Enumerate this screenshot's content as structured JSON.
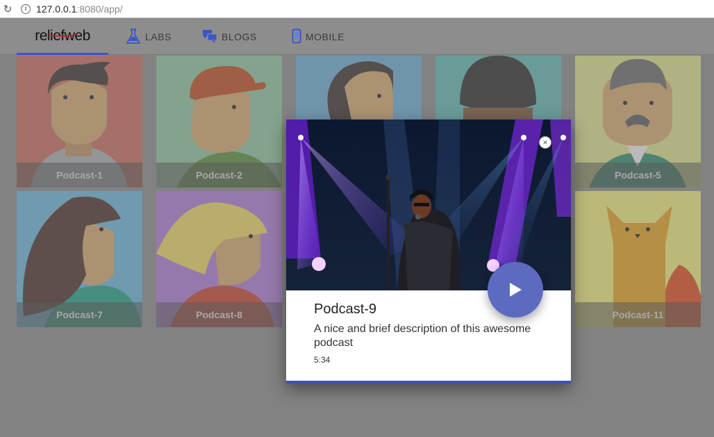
{
  "browser": {
    "reload_icon": "reload-icon",
    "url_host": "127.0.0.1",
    "url_rest": ":8080/app/"
  },
  "nav": {
    "logo": "reliefweb",
    "items": [
      {
        "label": "LABS",
        "icon": "flask-icon"
      },
      {
        "label": "BLOGS",
        "icon": "chat-bubbles-icon"
      },
      {
        "label": "MOBILE",
        "icon": "phone-icon"
      }
    ]
  },
  "podcasts": [
    {
      "label": "Podcast-1"
    },
    {
      "label": "Podcast-2"
    },
    {
      "label": "Podcast-5"
    },
    {
      "label": "Podcast-7"
    },
    {
      "label": "Podcast-8"
    },
    {
      "label": "Podcast-11"
    }
  ],
  "dialog": {
    "title": "Podcast-9",
    "description": "A nice and brief description of this awesome podcast",
    "duration": "5:34",
    "close_label": "×",
    "play_icon": "play-icon"
  },
  "colors": {
    "accent": "#3f51b5",
    "play": "#5c6bc0"
  }
}
